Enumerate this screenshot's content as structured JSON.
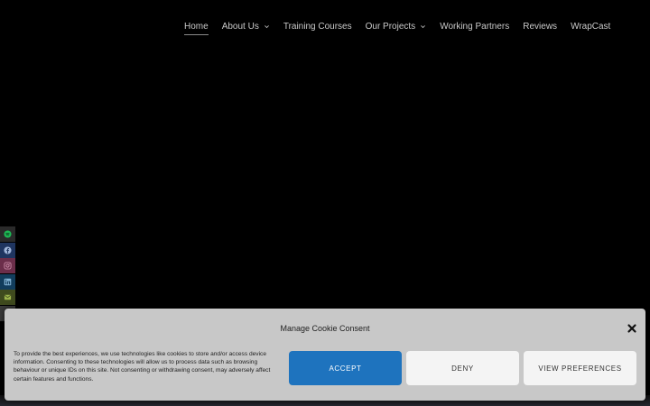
{
  "nav": {
    "items": [
      {
        "label": "Home",
        "active": true
      },
      {
        "label": "About Us",
        "dropdown": true
      },
      {
        "label": "Training Courses"
      },
      {
        "label": "Our Projects",
        "dropdown": true
      },
      {
        "label": "Working Partners"
      },
      {
        "label": "Reviews"
      },
      {
        "label": "WrapCast"
      }
    ]
  },
  "social_rail": [
    {
      "icon": "spotify-icon",
      "color": "#2a2a2a",
      "icon_color": "#1db954"
    },
    {
      "icon": "facebook-icon",
      "color": "#1f3560",
      "icon_color": "#9fb4d8"
    },
    {
      "icon": "instagram-icon",
      "color": "#6b2e4a",
      "icon_color": "#c98aa6"
    },
    {
      "icon": "linkedin-icon",
      "color": "#123d5c",
      "icon_color": "#7fb0d2"
    },
    {
      "icon": "email-icon",
      "color": "#3f4a1e",
      "icon_color": "#9bb24a"
    },
    {
      "icon": "share-icon",
      "color": "#3a3a3a",
      "icon_color": "#9a9a9a"
    }
  ],
  "cookie": {
    "title": "Manage Cookie Consent",
    "text": "To provide the best experiences, we use technologies like cookies to store and/or access device information. Consenting to these technologies will allow us to process data such as browsing behaviour or unique IDs on this site. Not consenting or withdrawing consent, may adversely affect certain features and functions.",
    "accept_label": "ACCEPT",
    "deny_label": "DENY",
    "prefs_label": "VIEW PREFERENCES",
    "accent_color": "#1e73be"
  }
}
